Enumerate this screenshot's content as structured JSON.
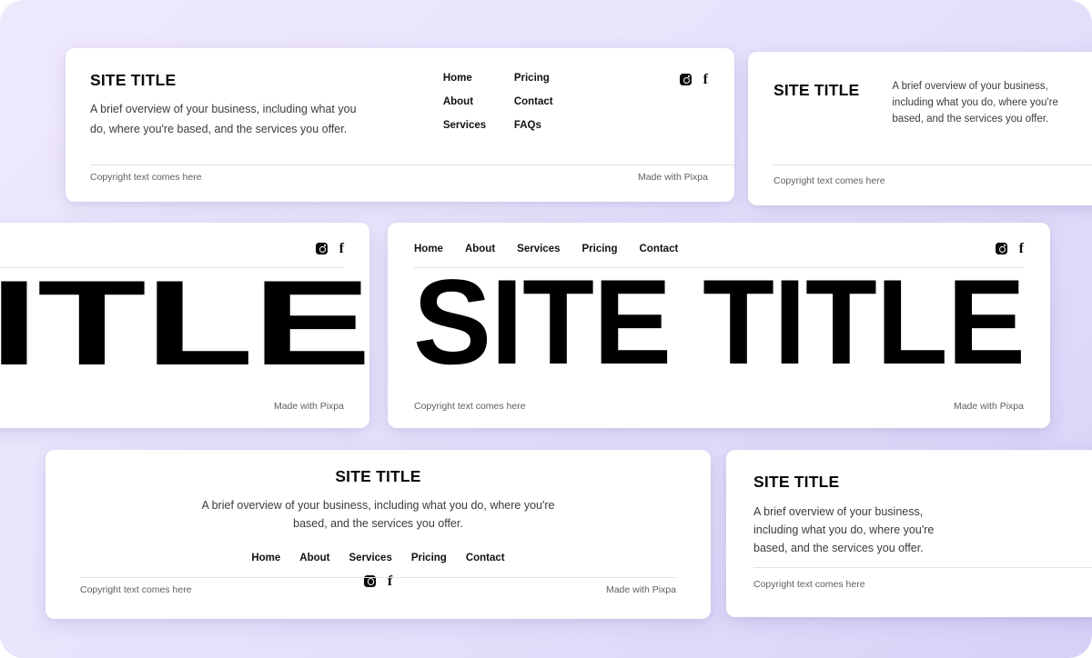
{
  "theme": {
    "background_start": "#efe9fd",
    "background_end": "#d6d0f7",
    "card_background": "#ffffff",
    "text_primary": "#0b0b0c",
    "text_muted": "#5d5d66",
    "divider": "#e3e3e8"
  },
  "common": {
    "site_title": "SITE TITLE",
    "blurb": "A brief overview of your business, including what you do, where you're based, and the services you offer.",
    "copyright": "Copyright text comes here",
    "made_with": "Made with Pixpa",
    "icons": {
      "instagram": "instagram-icon",
      "facebook": "facebook-icon"
    }
  },
  "cards": [
    {
      "id": "footer-layout-1",
      "site_title": "SITE TITLE",
      "blurb": "A brief overview of your business, including what you do, where you're based, and the services you offer.",
      "nav": [
        "Home",
        "Pricing",
        "About",
        "Contact",
        "Services",
        "FAQs"
      ],
      "copyright": "Copyright text comes here",
      "made_with": "Made with Pixpa"
    },
    {
      "id": "footer-layout-2",
      "site_title": "SITE TITLE",
      "blurb": "A brief overview of your business, including what you do, where you're based, and the services you offer.",
      "copyright": "Copyright text comes here"
    },
    {
      "id": "footer-layout-3",
      "giant_title": "TITLE",
      "made_with": "Made with Pixpa"
    },
    {
      "id": "footer-layout-4",
      "giant_title": "SITE TITLE",
      "nav": [
        "Home",
        "About",
        "Services",
        "Pricing",
        "Contact"
      ],
      "copyright": "Copyright text comes here",
      "made_with": "Made with Pixpa"
    },
    {
      "id": "footer-layout-5",
      "site_title": "SITE TITLE",
      "blurb": "A brief overview of your business, including what you do, where you're based, and the services you offer.",
      "nav": [
        "Home",
        "About",
        "Services",
        "Pricing",
        "Contact"
      ],
      "copyright": "Copyright text comes here",
      "made_with": "Made with Pixpa"
    },
    {
      "id": "footer-layout-6",
      "site_title": "SITE TITLE",
      "blurb": "A brief overview of your business, including what you do, where you're based, and the services you offer.",
      "copyright": "Copyright text comes here"
    }
  ]
}
